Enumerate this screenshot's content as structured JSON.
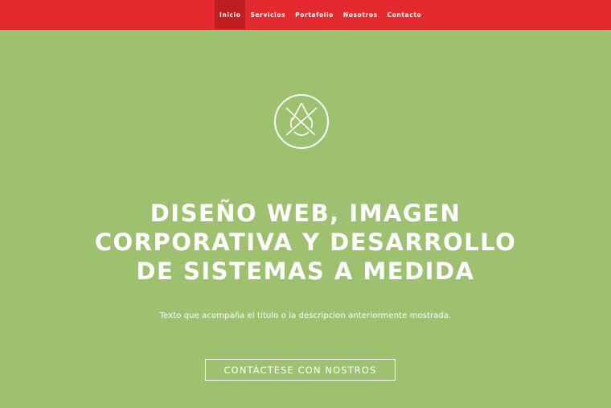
{
  "nav": {
    "items": [
      {
        "label": "Inicio",
        "active": true
      },
      {
        "label": "Servicios",
        "active": false
      },
      {
        "label": "Portafolio",
        "active": false
      },
      {
        "label": "Nosotros",
        "active": false
      },
      {
        "label": "Contacto",
        "active": false
      }
    ]
  },
  "hero": {
    "logo_icon": "droplet-crossed-circle-icon",
    "title_lines": [
      "DISEÑO WEB, IMAGEN",
      "CORPORATIVA Y DESARROLLO",
      "DE SISTEMAS A MEDIDA"
    ],
    "subtitle": "Texto que acompaña el titulo o la descripcion anteriormente mostrada.",
    "cta_label": "CONTÁCTESE CON NOSTROS"
  },
  "colors": {
    "navbar": "#e4292f",
    "nav_active": "#bf1d22",
    "background": "#9ec170",
    "text": "#ffffff"
  }
}
